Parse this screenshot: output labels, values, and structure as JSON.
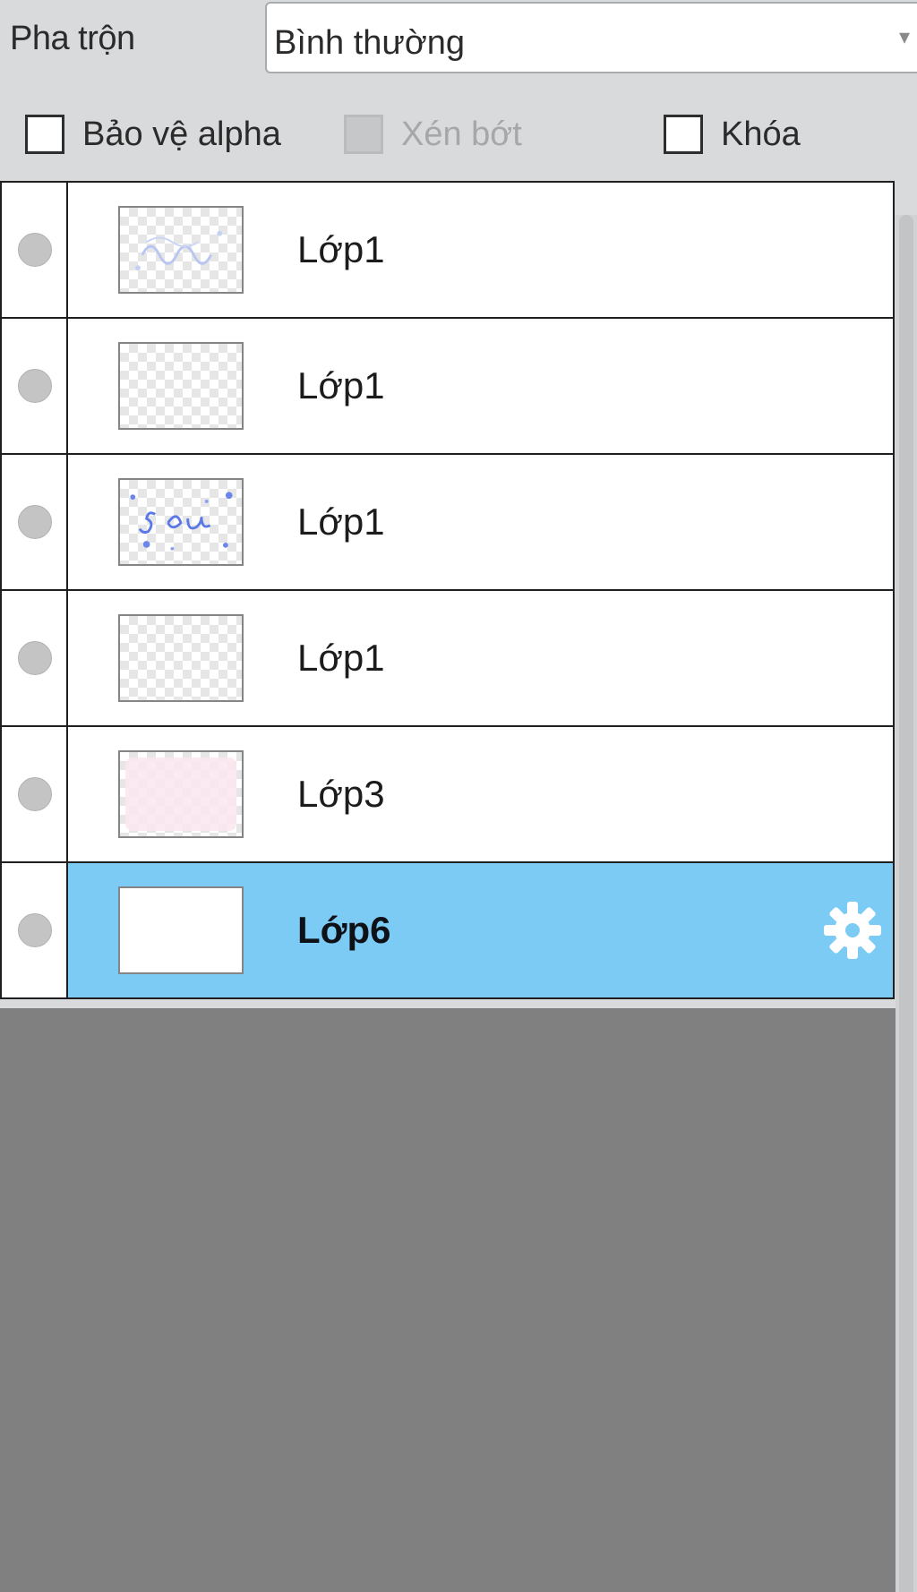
{
  "blend": {
    "label": "Pha trộn",
    "value": "Bình thường"
  },
  "options": [
    {
      "label": "Bảo vệ alpha",
      "checked": false,
      "disabled": false
    },
    {
      "label": "Xén bớt",
      "checked": false,
      "disabled": true
    },
    {
      "label": "Khóa",
      "checked": false,
      "disabled": false
    }
  ],
  "layers": [
    {
      "name": "Lớp1",
      "thumbnail": "blue-sketch-faint",
      "selected": false
    },
    {
      "name": "Lớp1",
      "thumbnail": "transparent",
      "selected": false
    },
    {
      "name": "Lớp1",
      "thumbnail": "blue-sketch",
      "selected": false
    },
    {
      "name": "Lớp1",
      "thumbnail": "transparent",
      "selected": false
    },
    {
      "name": "Lớp3",
      "thumbnail": "pink-fill",
      "selected": false
    },
    {
      "name": "Lớp6",
      "thumbnail": "white",
      "selected": true
    }
  ],
  "colors": {
    "selected_row": "#7ccbf5",
    "panel_bg": "#d8dadb",
    "empty_area": "#808080"
  },
  "icons": {
    "visibility": "visibility-dot-icon",
    "settings": "gear-icon",
    "dropdown": "chevron-down-icon"
  }
}
